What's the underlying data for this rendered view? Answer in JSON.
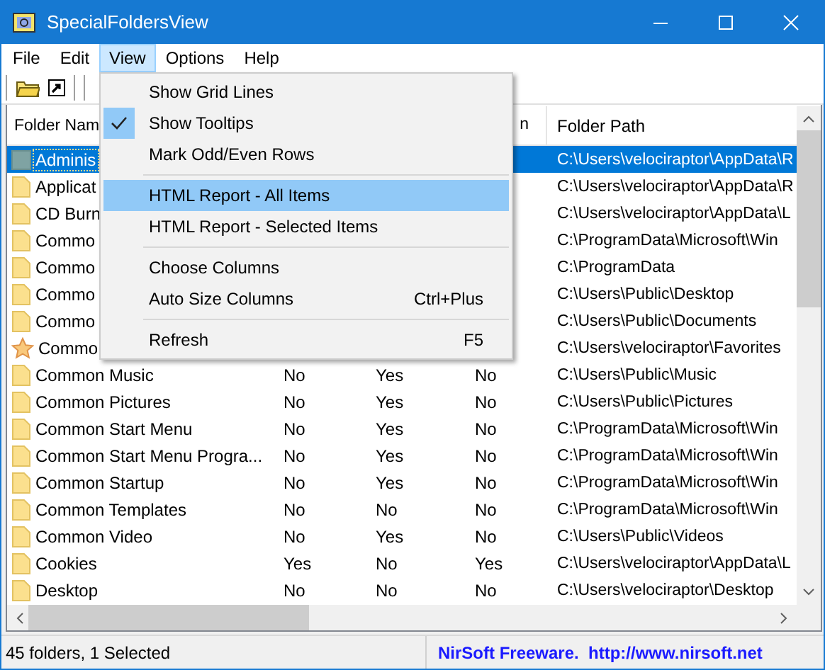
{
  "window": {
    "title": "SpecialFoldersView"
  },
  "menubar": [
    {
      "label": "File",
      "selected": false
    },
    {
      "label": "Edit",
      "selected": false
    },
    {
      "label": "View",
      "selected": true
    },
    {
      "label": "Options",
      "selected": false
    },
    {
      "label": "Help",
      "selected": false
    }
  ],
  "table": {
    "header": {
      "name": "Folder Nam",
      "column_4": "n",
      "path": "Folder Path"
    },
    "rows": [
      {
        "kind": "tile",
        "name": "Adminis",
        "path": "C:\\Users\\velociraptor\\AppData\\R",
        "selected": true
      },
      {
        "kind": "folder",
        "name": "Applicat",
        "path": "C:\\Users\\velociraptor\\AppData\\R",
        "selected": false
      },
      {
        "kind": "folder",
        "name": "CD Burn",
        "path": "C:\\Users\\velociraptor\\AppData\\L",
        "selected": false
      },
      {
        "kind": "folder",
        "name": "Commo",
        "path": "C:\\ProgramData\\Microsoft\\Win",
        "selected": false
      },
      {
        "kind": "folder",
        "name": "Commo",
        "path": "C:\\ProgramData",
        "selected": false
      },
      {
        "kind": "folder",
        "name": "Commo",
        "path": "C:\\Users\\Public\\Desktop",
        "selected": false
      },
      {
        "kind": "folder",
        "name": "Commo",
        "path": "C:\\Users\\Public\\Documents",
        "selected": false
      },
      {
        "kind": "star",
        "name": "Commo",
        "path": "C:\\Users\\velociraptor\\Favorites",
        "selected": false
      },
      {
        "kind": "folder",
        "name": "Common Music",
        "cells": [
          "No",
          "Yes",
          "No"
        ],
        "path": "C:\\Users\\Public\\Music",
        "selected": false
      },
      {
        "kind": "folder",
        "name": "Common Pictures",
        "cells": [
          "No",
          "Yes",
          "No"
        ],
        "path": "C:\\Users\\Public\\Pictures",
        "selected": false
      },
      {
        "kind": "folder",
        "name": "Common Start Menu",
        "cells": [
          "No",
          "Yes",
          "No"
        ],
        "path": "C:\\ProgramData\\Microsoft\\Win",
        "selected": false
      },
      {
        "kind": "folder",
        "name": "Common Start Menu Progra...",
        "cells": [
          "No",
          "Yes",
          "No"
        ],
        "path": "C:\\ProgramData\\Microsoft\\Win",
        "selected": false
      },
      {
        "kind": "folder",
        "name": "Common Startup",
        "cells": [
          "No",
          "Yes",
          "No"
        ],
        "path": "C:\\ProgramData\\Microsoft\\Win",
        "selected": false
      },
      {
        "kind": "folder",
        "name": "Common Templates",
        "cells": [
          "No",
          "No",
          "No"
        ],
        "path": "C:\\ProgramData\\Microsoft\\Win",
        "selected": false
      },
      {
        "kind": "folder",
        "name": "Common Video",
        "cells": [
          "No",
          "Yes",
          "No"
        ],
        "path": "C:\\Users\\Public\\Videos",
        "selected": false
      },
      {
        "kind": "folder",
        "name": "Cookies",
        "cells": [
          "Yes",
          "No",
          "Yes"
        ],
        "path": "C:\\Users\\velociraptor\\AppData\\L",
        "selected": false
      },
      {
        "kind": "folder",
        "name": "Desktop",
        "cells": [
          "No",
          "No",
          "No"
        ],
        "path": "C:\\Users\\velociraptor\\Desktop",
        "selected": false
      }
    ]
  },
  "view_menu": [
    {
      "kind": "item",
      "label": "Show Grid Lines",
      "checked": false,
      "selected": false
    },
    {
      "kind": "item",
      "label": "Show Tooltips",
      "checked": true,
      "selected": false
    },
    {
      "kind": "item",
      "label": "Mark Odd/Even Rows",
      "checked": false,
      "selected": false
    },
    {
      "kind": "separator"
    },
    {
      "kind": "item",
      "label": "HTML Report - All Items",
      "checked": false,
      "selected": true
    },
    {
      "kind": "item",
      "label": "HTML Report - Selected Items",
      "checked": false,
      "selected": false
    },
    {
      "kind": "separator"
    },
    {
      "kind": "item",
      "label": "Choose Columns",
      "checked": false,
      "selected": false
    },
    {
      "kind": "item",
      "label": "Auto Size Columns",
      "shortcut": "Ctrl+Plus",
      "checked": false,
      "selected": false
    },
    {
      "kind": "separator"
    },
    {
      "kind": "item",
      "label": "Refresh",
      "shortcut": "F5",
      "checked": false,
      "selected": false
    }
  ],
  "status_bar": {
    "summary": "45 folders, 1 Selected",
    "credit": "NirSoft Freeware.  http://www.nirsoft.net"
  }
}
